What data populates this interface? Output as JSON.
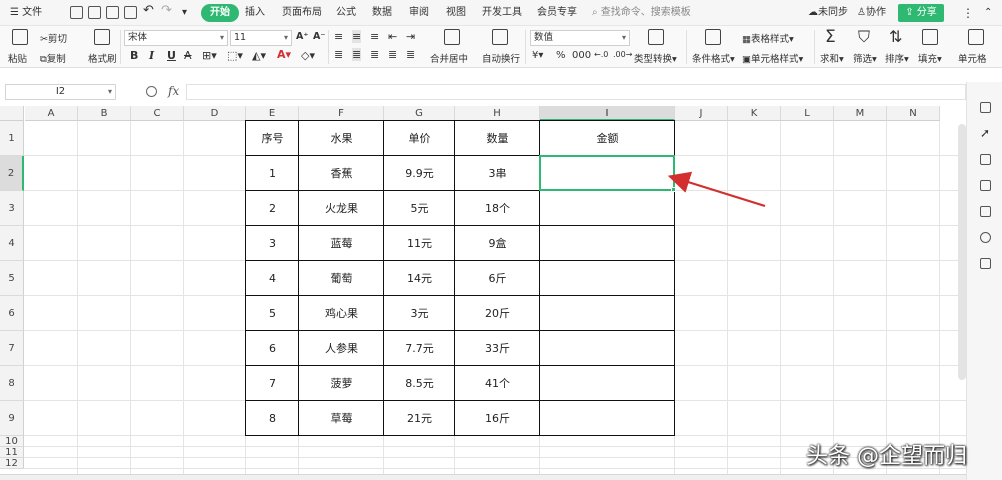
{
  "menu": {
    "file": "文件",
    "tabs": [
      "开始",
      "插入",
      "页面布局",
      "公式",
      "数据",
      "审阅",
      "视图",
      "开发工具",
      "会员专享"
    ],
    "active_tab": "开始",
    "search": "查找命令、搜索模板",
    "sync": "未同步",
    "collab": "协作",
    "share": "分享"
  },
  "ribbon": {
    "paste": "粘贴",
    "cut": "剪切",
    "copy": "复制",
    "format_painter": "格式刷",
    "font_name": "宋体",
    "font_size": "11",
    "style_buttons": [
      "B",
      "I",
      "U",
      "A"
    ],
    "merge_center": "合并居中",
    "wrap_text": "自动换行",
    "number_format": "数值",
    "type_convert": "类型转换",
    "conditional_format": "条件格式",
    "table_style": "表格样式",
    "cell_style": "单元格样式",
    "sum": "求和",
    "filter": "筛选",
    "sort": "排序",
    "fill": "填充",
    "cells": "单元格"
  },
  "formula_bar": {
    "name_box": "I2",
    "fx": "fx",
    "content": ""
  },
  "grid": {
    "columns": [
      "A",
      "B",
      "C",
      "D",
      "E",
      "F",
      "G",
      "H",
      "I",
      "J",
      "K",
      "L",
      "M",
      "N"
    ],
    "rows": [
      "1",
      "2",
      "3",
      "4",
      "5",
      "6",
      "7",
      "8",
      "9",
      "10",
      "11",
      "12"
    ],
    "selected_column": "I",
    "selected_row": "2"
  },
  "table": {
    "headers": [
      "序号",
      "水果",
      "单价",
      "数量",
      "金额"
    ],
    "rows": [
      [
        "1",
        "香蕉",
        "9.9元",
        "3串",
        ""
      ],
      [
        "2",
        "火龙果",
        "5元",
        "18个",
        ""
      ],
      [
        "3",
        "蓝莓",
        "11元",
        "9盒",
        ""
      ],
      [
        "4",
        "葡萄",
        "14元",
        "6斤",
        ""
      ],
      [
        "5",
        "鸡心果",
        "3元",
        "20斤",
        ""
      ],
      [
        "6",
        "人参果",
        "7.7元",
        "33斤",
        ""
      ],
      [
        "7",
        "菠萝",
        "8.5元",
        "41个",
        ""
      ],
      [
        "8",
        "草莓",
        "21元",
        "16斤",
        ""
      ]
    ]
  },
  "watermark": "头条 @企望而归",
  "colors": {
    "accent": "#2eb872",
    "arrow": "#d32f2f"
  }
}
